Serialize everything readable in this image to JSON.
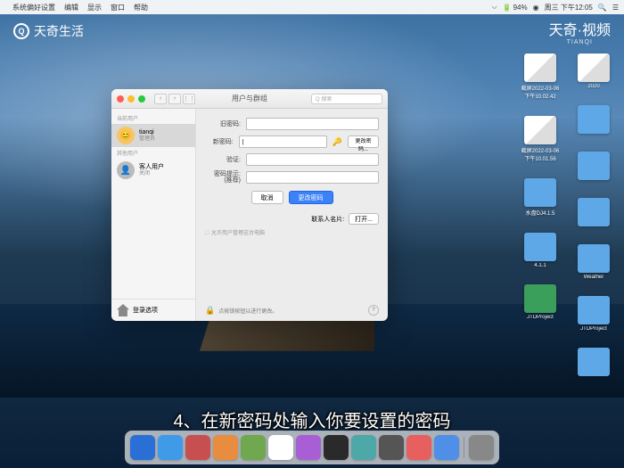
{
  "menubar": {
    "app": "系统偏好设置",
    "items": [
      "编辑",
      "显示",
      "窗口",
      "帮助"
    ],
    "battery": "94%",
    "date": "周三 下午12:05"
  },
  "watermark": {
    "left": "天奇生活",
    "right_main": "天奇·视频",
    "right_sub": "TIANQI"
  },
  "desktop_icons": {
    "col1": [
      "2020",
      "",
      "",
      "",
      "Weather",
      "JTDProject",
      ""
    ],
    "col2": [
      "截屏2022-03-06下午10.02.42",
      "截屏2022-03-06下午10.01.56",
      "水盘DJ4.1.5",
      "4.1.1",
      "JTDProject"
    ]
  },
  "window": {
    "title": "用户与群组",
    "search_placeholder": "Q 搜索",
    "sidebar": {
      "section1": "当前用户",
      "user1": {
        "name": "tianqi",
        "role": "管理员"
      },
      "section2": "其他用户",
      "user2": {
        "name": "客人用户",
        "role": "关闭"
      },
      "login_options": "登录选项"
    },
    "form": {
      "old_pwd_label": "旧密码:",
      "new_pwd_label": "新密码:",
      "new_pwd_value": "|",
      "change_pwd_btn": "更改密码...",
      "verify_label": "验证:",
      "hint_label": "密码提示:\n(推荐)",
      "cancel": "取消",
      "confirm": "更改密码",
      "contact": "联系人名片:",
      "open": "打开...",
      "admin_hint": "允许用户管理这台电脑"
    },
    "lock_text": "点按锁按钮以进行更改。"
  },
  "subtitle": "4、在新密码处输入你要设置的密码",
  "dock_colors": [
    "#2a6fd6",
    "#3f9ae8",
    "#c84f4f",
    "#e88c3f",
    "#6fa84f",
    "#ffffff",
    "#a85fd6",
    "#2a2a2a",
    "#4fa8a8",
    "#555",
    "#e85f5f",
    "#4f8fe8",
    "#888"
  ]
}
